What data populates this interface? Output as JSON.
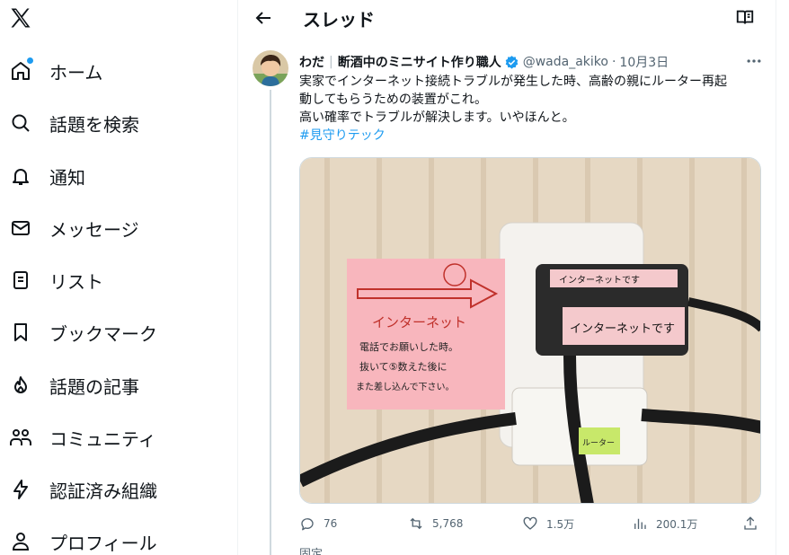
{
  "nav": {
    "items": [
      {
        "label": "ホーム",
        "icon": "home-icon"
      },
      {
        "label": "話題を検索",
        "icon": "search-icon"
      },
      {
        "label": "通知",
        "icon": "bell-icon"
      },
      {
        "label": "メッセージ",
        "icon": "mail-icon"
      },
      {
        "label": "リスト",
        "icon": "list-icon"
      },
      {
        "label": "ブックマーク",
        "icon": "bookmark-icon"
      },
      {
        "label": "話題の記事",
        "icon": "flame-icon"
      },
      {
        "label": "コミュニティ",
        "icon": "community-icon"
      },
      {
        "label": "認証済み組織",
        "icon": "lightning-icon"
      },
      {
        "label": "プロフィール",
        "icon": "person-icon"
      }
    ],
    "accent": "#1d9bf0"
  },
  "header": {
    "title": "スレッド"
  },
  "tweet": {
    "name": "わだ",
    "separator": "|",
    "display_name_2": "断酒中のミニサイト作り職人",
    "handle": "@wada_akiko",
    "middot": "·",
    "date": "10月3日",
    "body_lines": [
      "実家でインターネット接続トラブルが発生した時、高齢の親にルーター再起",
      "動してもらうための装置がこれ。",
      "高い確率でトラブルが解決します。いやほんと。"
    ],
    "hashtag": "#見守りテック",
    "image": {
      "sticky_note_title": "インターネット",
      "sticky_note_line1": "電話でお願いした時。",
      "sticky_note_line2": "抜いて⑤数えた後に",
      "sticky_note_line3": "また差し込んで下さい。",
      "adapter_label": "インターネットです",
      "adapter_small_label": "インターネットです",
      "tag_label": "ルーター"
    },
    "actions": {
      "replies": "76",
      "retweets": "5,768",
      "likes": "1.5万",
      "views": "200.1万"
    }
  },
  "footer_cut": "固定"
}
